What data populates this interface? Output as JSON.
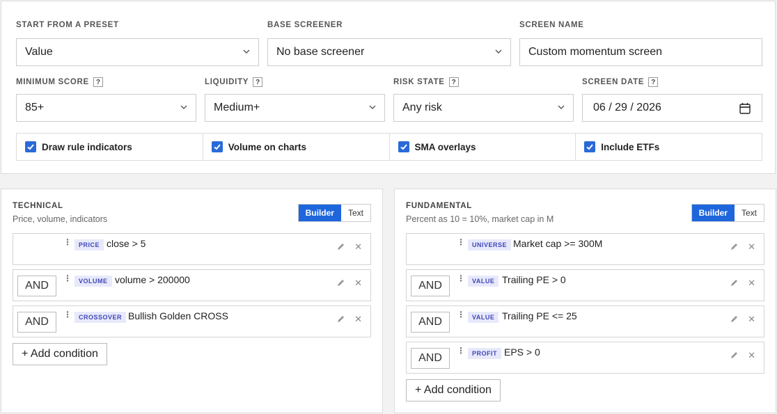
{
  "filters": {
    "preset": {
      "label": "START FROM A PRESET",
      "value": "Value"
    },
    "base": {
      "label": "BASE SCREENER",
      "value": "No base screener"
    },
    "name": {
      "label": "SCREEN NAME",
      "value": "Custom momentum screen"
    },
    "min_score": {
      "label": "MINIMUM SCORE",
      "value": "85+"
    },
    "liquidity": {
      "label": "LIQUIDITY",
      "value": "Medium+"
    },
    "risk": {
      "label": "RISK STATE",
      "value": "Any risk"
    },
    "date": {
      "label": "SCREEN DATE",
      "value": "06 / 29 / 2026"
    },
    "help": "?"
  },
  "checkboxes": [
    {
      "label": "Draw rule indicators",
      "checked": true
    },
    {
      "label": "Volume on charts",
      "checked": true
    },
    {
      "label": "SMA overlays",
      "checked": true
    },
    {
      "label": "Include ETFs",
      "checked": true
    }
  ],
  "technical": {
    "title": "TECHNICAL",
    "subtitle": "Price, volume, indicators",
    "toggle": [
      "Builder",
      "Text"
    ],
    "conditions": [
      {
        "op": "",
        "tag": "PRICE",
        "text": "close > 5"
      },
      {
        "op": "AND",
        "tag": "VOLUME",
        "text": "volume > 200000"
      },
      {
        "op": "AND",
        "tag": "CROSSOVER",
        "text": "Bullish Golden CROSS"
      }
    ],
    "add_label": "+ Add condition"
  },
  "fundamental": {
    "title": "FUNDAMENTAL",
    "subtitle": "Percent as 10 = 10%, market cap in M",
    "toggle": [
      "Builder",
      "Text"
    ],
    "conditions": [
      {
        "op": "",
        "tag": "UNIVERSE",
        "text": "Market cap >= 300M"
      },
      {
        "op": "AND",
        "tag": "VALUE",
        "text": "Trailing PE > 0"
      },
      {
        "op": "AND",
        "tag": "VALUE",
        "text": "Trailing PE <= 25"
      },
      {
        "op": "AND",
        "tag": "PROFIT",
        "text": "EPS > 0"
      }
    ],
    "add_label": "+ Add condition"
  }
}
